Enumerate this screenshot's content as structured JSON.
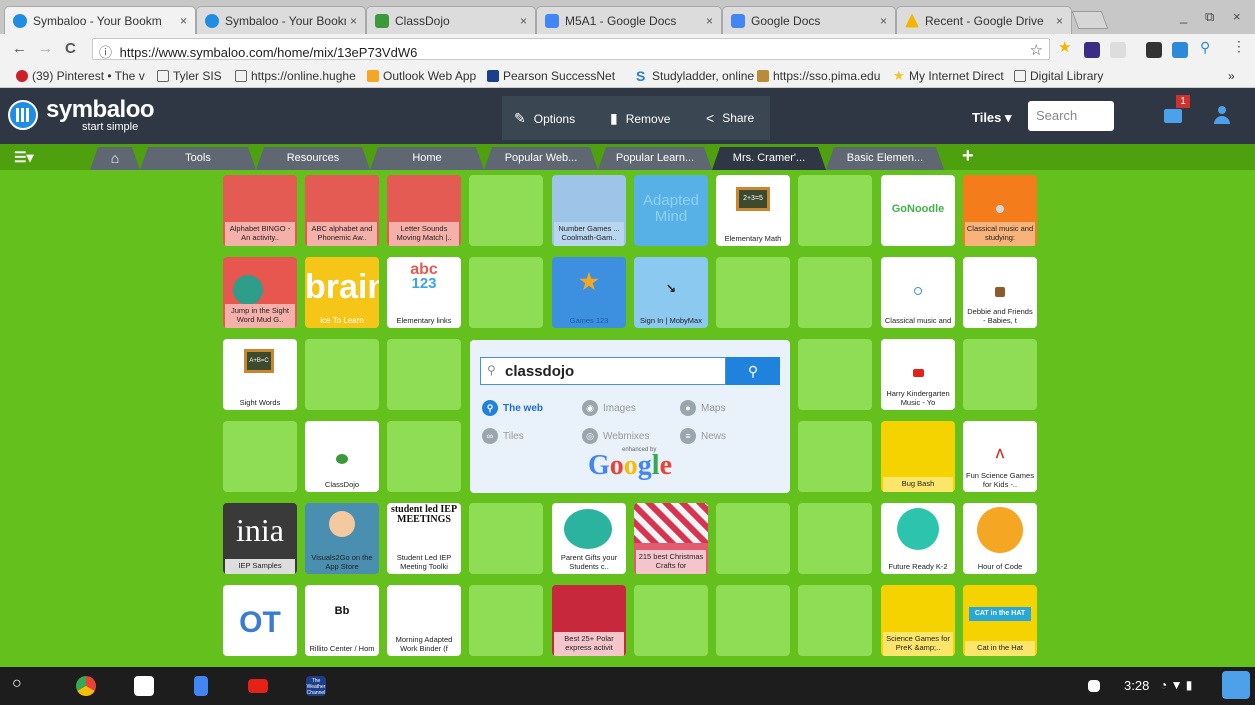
{
  "browser": {
    "tabs": [
      {
        "label": "Symbaloo - Your Bookm",
        "active": true,
        "color": "#1f8de4"
      },
      {
        "label": "Symbaloo - Your Bookm",
        "active": false,
        "color": "#1f8de4"
      },
      {
        "label": "ClassDojo",
        "active": false,
        "color": "#3c9a3c"
      },
      {
        "label": "M5A1 - Google Docs",
        "active": false,
        "color": "#4285f4"
      },
      {
        "label": "Google Docs",
        "active": false,
        "color": "#4285f4"
      },
      {
        "label": "Recent - Google Drive",
        "active": false,
        "color": "#f4b400"
      }
    ],
    "tab_close": "×",
    "win_minimize": "_",
    "win_restore": "⧉",
    "win_close": "×",
    "nav_back": "←",
    "nav_forward": "→",
    "nav_reload": "C",
    "url_info": "ⓘ",
    "url": "https://www.symbaloo.com/home/mix/13eP73VdW6",
    "star": "☆",
    "bookmarks": [
      {
        "label": "(39) Pinterest • The v",
        "color": "#cb2027"
      },
      {
        "label": "Tyler SIS",
        "color": "#ffffff"
      },
      {
        "label": "https://online.hughe",
        "color": "#ffffff"
      },
      {
        "label": "Outlook Web App",
        "color": "#f5a623"
      },
      {
        "label": "Pearson SuccessNet",
        "color": "#1c3f8a"
      },
      {
        "label": "Studyladder, online e",
        "color": "#2a7ec9"
      },
      {
        "label": "https://sso.pima.edu",
        "color": "#8e8e8e"
      },
      {
        "label": "My Internet Direct",
        "color": "#f5c518"
      },
      {
        "label": "Digital Library",
        "color": "#ffffff"
      }
    ],
    "bookmarks_more": "»"
  },
  "symbaloo": {
    "logo": "symbaloo",
    "logo_sub": "start simple",
    "toolbar": {
      "options": "Options",
      "remove": "Remove",
      "share": "Share"
    },
    "tiles_dropdown": "Tiles ▾",
    "search_placeholder": "Search",
    "mail_count": "1",
    "mix_menu": "☰▾",
    "mix_tabs": [
      "Tools",
      "Resources",
      "Home",
      "Popular Web...",
      "Popular Learn...",
      "Mrs. Cramer'...",
      "Basic Elemen..."
    ],
    "add_mix": "+"
  },
  "colors": {
    "page_bg": "#64c01c",
    "header_bg": "#2e3743",
    "empty_tile": "#8fdc55",
    "accent": "#1f82dc"
  },
  "tiles": {
    "r1c1": "Alphabet BINGO - An activity..",
    "r1c2": "ABC alphabet and Phonemic Aw..",
    "r1c3": "Letter Sounds Moving Match |..",
    "r1c5": "Number Games ... Coolmath-Gam..",
    "r1c6_logo": "Adapted Mind",
    "r1c7": "Elementary Math",
    "r1c7_logo": "2+3=5",
    "r1c9_logo": "GoNoodle",
    "r1c10": "Classical music and studying:",
    "r2c1": "Jump in the Sight Word Mud G..",
    "r2c2_logo": "brain",
    "r2c2_sub": "ice To Learn",
    "r2c3_logo_a": "abc",
    "r2c3_logo_b": "123",
    "r2c3": "Elementary links",
    "r2c5": "Games 123",
    "r2c6": "Sign In | MobyMax",
    "r2c9": "Classical music and",
    "r2c10": "Debbie and Friends - Babies, t",
    "r3c1_logo": "A+B=C",
    "r3c1": "Sight Words",
    "r3c9": "Harry Kindergarten Music - Yo",
    "r4c2": "ClassDojo",
    "r4c9": "Bug Bash",
    "r4c10": "Fun Science Games for Kids -..",
    "r5c1_logo": "inia",
    "r5c1": "IEP Samples",
    "r5c2": "Visuals2Go on the App Store",
    "r5c3_logo": "student led IEP MEETINGS",
    "r5c3": "Student Led IEP Meeting Toolki",
    "r5c5": "Parent Gifts your Students c..",
    "r5c6": "215 best Christmas Crafts for",
    "r5c9": "Future Ready K-2",
    "r5c10": "Hour of Code",
    "r6c1_logo": "OT",
    "r6c2_logo": "Bb",
    "r6c2": "Rillito Center / Hom",
    "r6c3": "Morning Adapted Work Binder (f",
    "r6c5": "Best 25+ Polar express activit",
    "r6c9": "Science Games for PreK &amp;..",
    "r6c10_logo": "CAT in the HAT",
    "r6c10": "Cat in the Hat"
  },
  "search_widget": {
    "query": "classdojo",
    "search_icon": "🔍",
    "options": {
      "web": "The web",
      "images": "Images",
      "maps": "Maps",
      "tiles": "Tiles",
      "webmixes": "Webmixes",
      "news": "News"
    },
    "enhanced_by": "enhanced by",
    "google": "Google"
  },
  "shelf": {
    "launcher": "○",
    "weather_label": "The Weather Channel",
    "clock": "3:28"
  }
}
